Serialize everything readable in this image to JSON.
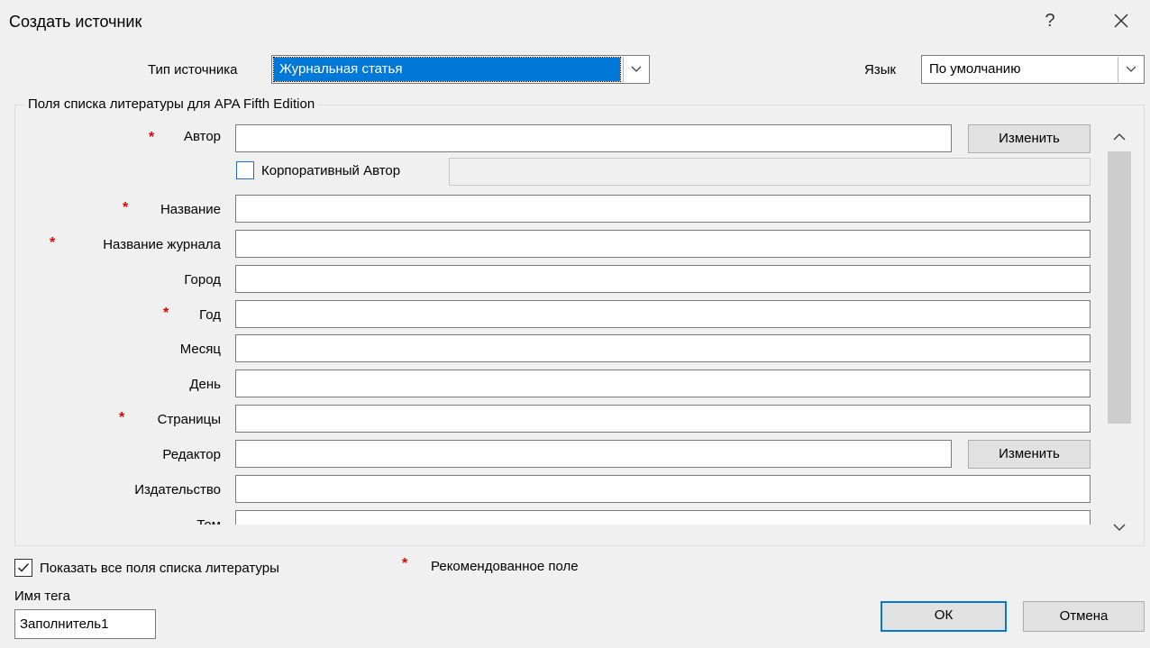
{
  "dialog": {
    "title": "Создать источник",
    "help": "?",
    "close_icon": "close-icon"
  },
  "source_type": {
    "label": "Тип источника",
    "value": "Журнальная статья"
  },
  "language": {
    "label": "Язык",
    "value": "По умолчанию"
  },
  "group": {
    "title": "Поля списка литературы для APA Fifth Edition"
  },
  "fields": {
    "author": {
      "label": "Автор",
      "required": true,
      "value": "",
      "button": "Изменить"
    },
    "corporate_author": {
      "label": "Корпоративный Автор",
      "checked": false,
      "value": ""
    },
    "title": {
      "label": "Название",
      "required": true,
      "value": ""
    },
    "journal_name": {
      "label": "Название журнала",
      "required": true,
      "value": ""
    },
    "city": {
      "label": "Город",
      "required": false,
      "value": ""
    },
    "year": {
      "label": "Год",
      "required": true,
      "value": ""
    },
    "month": {
      "label": "Месяц",
      "required": false,
      "value": ""
    },
    "day": {
      "label": "День",
      "required": false,
      "value": ""
    },
    "pages": {
      "label": "Страницы",
      "required": true,
      "value": ""
    },
    "editor": {
      "label": "Редактор",
      "required": false,
      "value": "",
      "button": "Изменить"
    },
    "publisher": {
      "label": "Издательство",
      "required": false,
      "value": ""
    },
    "volume": {
      "label": "Том",
      "required": false,
      "value": ""
    }
  },
  "required_marker": "*",
  "show_all": {
    "label": "Показать все поля списка литературы",
    "checked": true
  },
  "legend": {
    "marker": "*",
    "text": "Рекомендованное поле"
  },
  "tag": {
    "label": "Имя тега",
    "value": "Заполнитель1"
  },
  "buttons": {
    "ok": "ОК",
    "cancel": "Отмена"
  },
  "colors": {
    "accent": "#0078d7",
    "required": "#e00000",
    "background": "#f0f0f0"
  }
}
